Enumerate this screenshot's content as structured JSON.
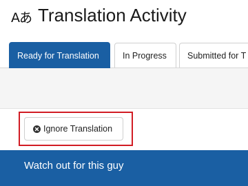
{
  "header": {
    "icon": "translate-icon",
    "icon_glyph": "Aあ",
    "title": "Translation Activity"
  },
  "tabs": [
    {
      "label": "Ready for Translation",
      "active": true
    },
    {
      "label": "In Progress",
      "active": false
    },
    {
      "label": "Submitted for T",
      "active": false
    }
  ],
  "actions": {
    "ignore_button_label": "Ignore Translation",
    "ignore_button_icon": "x-circle-icon",
    "highlight_color": "#d11b23"
  },
  "banner": {
    "text": "Watch out for this guy",
    "color": "#1a5fa3"
  },
  "colors": {
    "accent": "#1a5fa3",
    "highlight": "#d11b23"
  }
}
